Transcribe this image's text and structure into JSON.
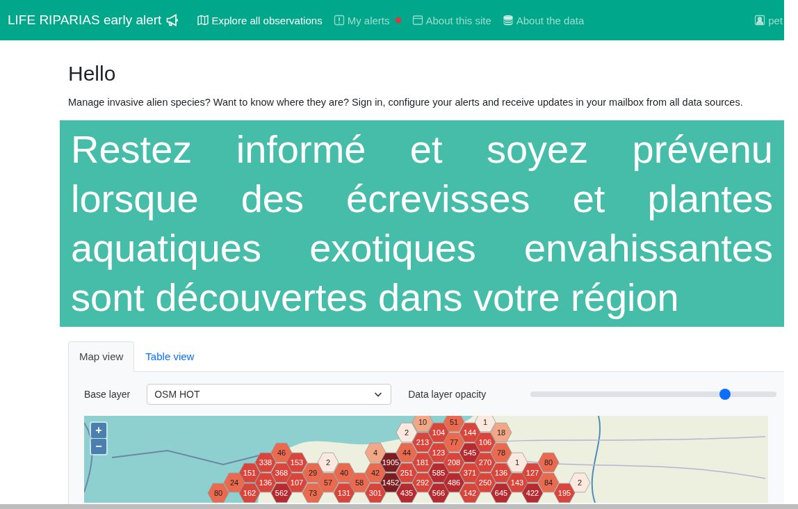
{
  "navbar": {
    "brand": "LIFE RIPARIAS early alert",
    "links": [
      {
        "label": "Explore all observations",
        "selected": true,
        "notification": false
      },
      {
        "label": "My alerts",
        "selected": false,
        "notification": true
      },
      {
        "label": "About this site",
        "selected": false,
        "notification": false
      },
      {
        "label": "About the data",
        "selected": false,
        "notification": false
      }
    ],
    "user": "pet"
  },
  "intro": {
    "title": "Hello",
    "text": "Manage invasive alien species? Want to know where they are? Sign in, configure your alerts and receive updates in your mailbox from all data sources."
  },
  "banner": {
    "text": "Restez informé et soyez prévenu lorsque des écrevisses et plantes aquatiques exotiques envahissantes sont découvertes dans votre région"
  },
  "tabs": [
    {
      "label": "Map view",
      "selected": true
    },
    {
      "label": "Table view",
      "selected": false
    }
  ],
  "map_controls": {
    "base_layer_label": "Base layer",
    "base_layer_value": "OSM HOT",
    "opacity_label": "Data layer opacity",
    "opacity": {
      "level": 0.79
    }
  },
  "map": {
    "zoom_in": "+",
    "zoom_out": "−",
    "hexagons": [
      {
        "count": "10"
      },
      {
        "count": "51"
      },
      {
        "count": "1"
      },
      {
        "count": "2"
      },
      {
        "count": "104"
      },
      {
        "count": "144"
      },
      {
        "count": "18"
      },
      {
        "count": "213"
      },
      {
        "count": "77"
      },
      {
        "count": "106"
      },
      {
        "count": "46"
      },
      {
        "count": "4"
      },
      {
        "count": "44"
      },
      {
        "count": "123"
      },
      {
        "count": "545"
      },
      {
        "count": "78"
      },
      {
        "count": "338"
      },
      {
        "count": "153"
      },
      {
        "count": "2"
      },
      {
        "count": "1905"
      },
      {
        "count": "181"
      },
      {
        "count": "208"
      },
      {
        "count": "270"
      },
      {
        "count": "1"
      },
      {
        "count": "80"
      },
      {
        "count": "151"
      },
      {
        "count": "368"
      },
      {
        "count": "29"
      },
      {
        "count": "40"
      },
      {
        "count": "42"
      },
      {
        "count": "251"
      },
      {
        "count": "585"
      },
      {
        "count": "371"
      },
      {
        "count": "136"
      },
      {
        "count": "127"
      },
      {
        "count": "24"
      },
      {
        "count": "136"
      },
      {
        "count": "107"
      },
      {
        "count": "57"
      },
      {
        "count": "58"
      },
      {
        "count": "1452"
      },
      {
        "count": "292"
      },
      {
        "count": "486"
      },
      {
        "count": "250"
      },
      {
        "count": "143"
      },
      {
        "count": "84"
      },
      {
        "count": "2"
      },
      {
        "count": "80"
      },
      {
        "count": "162"
      },
      {
        "count": "562"
      },
      {
        "count": "73"
      },
      {
        "count": "131"
      },
      {
        "count": "301"
      },
      {
        "count": "435"
      },
      {
        "count": "566"
      },
      {
        "count": "142"
      },
      {
        "count": "645"
      },
      {
        "count": "422"
      },
      {
        "count": "195"
      }
    ]
  }
}
